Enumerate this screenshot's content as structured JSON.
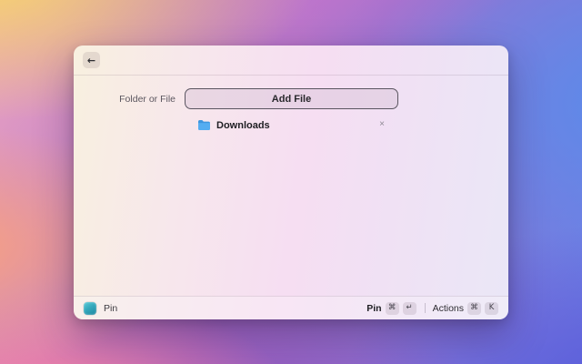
{
  "window": {
    "header": {
      "back_glyph": "←"
    },
    "form": {
      "field_label": "Folder or File",
      "add_button_label": "Add File",
      "files": [
        {
          "name": "Downloads",
          "icon": "blue-folder",
          "remove_glyph": "×"
        }
      ]
    },
    "footer": {
      "app_icon": "pin-extension-icon",
      "app_label": "Pin",
      "pin_label": "Pin",
      "pin_keys": [
        "⌘",
        "↵"
      ],
      "actions_label": "Actions",
      "actions_keys": [
        "⌘",
        "K"
      ]
    }
  },
  "colors": {
    "folder_blue": "#4AA7EE",
    "app_icon_teal": "#35A9BC",
    "button_border": "#5A5560",
    "window_tint_left": "#F8F0DF",
    "window_tint_right": "#EAE7F7"
  }
}
